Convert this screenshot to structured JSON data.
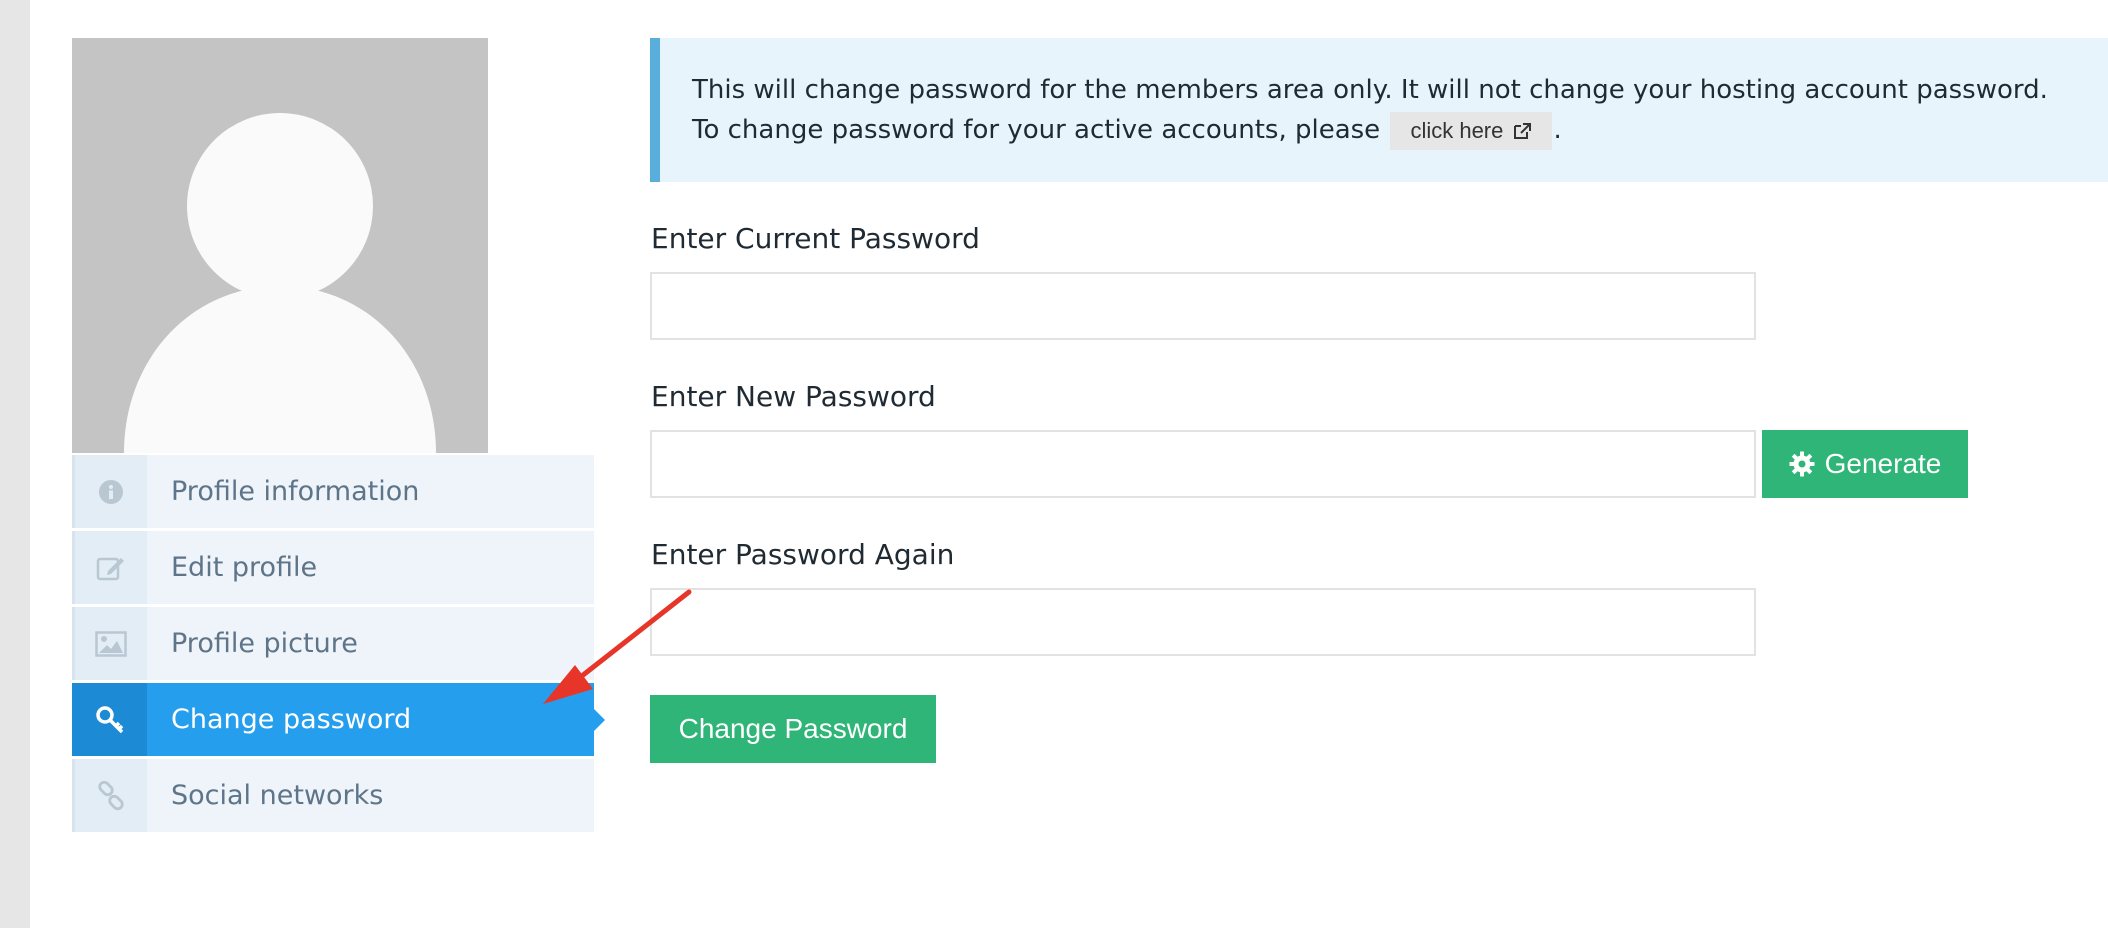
{
  "sidebar": {
    "avatar_alt": "default profile avatar",
    "menu": [
      {
        "label": "Profile information",
        "icon": "info-icon",
        "active": false
      },
      {
        "label": "Edit profile",
        "icon": "edit-icon",
        "active": false
      },
      {
        "label": "Profile picture",
        "icon": "image-icon",
        "active": false
      },
      {
        "label": "Change password",
        "icon": "key-icon",
        "active": true
      },
      {
        "label": "Social networks",
        "icon": "link-icon",
        "active": false
      }
    ]
  },
  "notice": {
    "line1": "This will change password for the members area only. It will not change your hosting account password.",
    "line2_prefix": "To change password for your active accounts, please",
    "link_label": "click here",
    "link_icon": "external-link-icon",
    "line2_suffix": "."
  },
  "form": {
    "current_label": "Enter Current Password",
    "current_value": "",
    "new_label": "Enter New Password",
    "new_value": "",
    "again_label": "Enter Password Again",
    "again_value": "",
    "generate_label": "Generate",
    "generate_icon": "gear-icon",
    "submit_label": "Change Password"
  },
  "colors": {
    "accent_blue": "#259eee",
    "green": "#2fb577",
    "notice_bg": "#e8f4fb",
    "notice_border": "#5aaedc",
    "annotation_arrow": "#e8352a"
  }
}
